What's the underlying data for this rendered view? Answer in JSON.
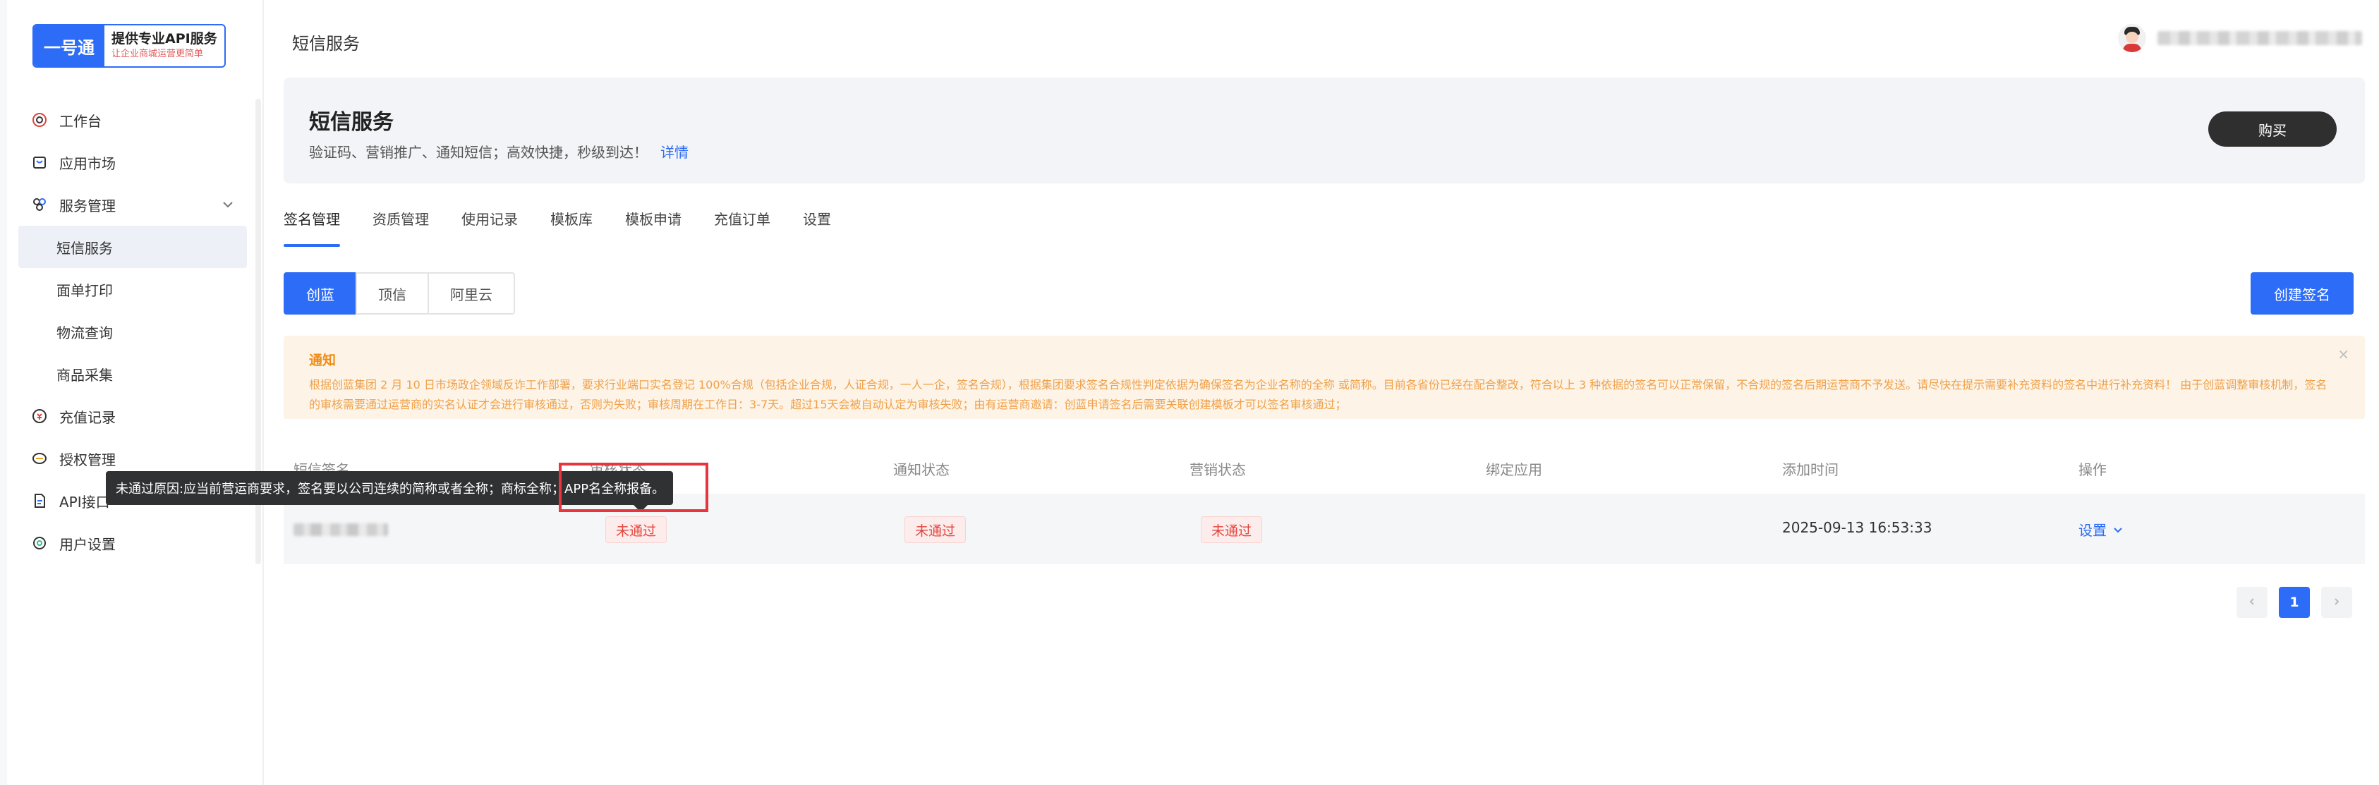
{
  "logo": {
    "mark": "一号通",
    "title": "提供专业API服务",
    "subtitle": "让企业商城运营更简单"
  },
  "sidebar": {
    "items": [
      {
        "label": "工作台"
      },
      {
        "label": "应用市场"
      },
      {
        "label": "服务管理"
      },
      {
        "label": "短信服务"
      },
      {
        "label": "面单打印"
      },
      {
        "label": "物流查询"
      },
      {
        "label": "商品采集"
      },
      {
        "label": "充值记录"
      },
      {
        "label": "授权管理"
      },
      {
        "label": "API接口"
      },
      {
        "label": "用户设置"
      }
    ]
  },
  "header": {
    "title": "短信服务"
  },
  "banner": {
    "title": "短信服务",
    "description": "验证码、营销推广、通知短信；高效快捷，秒级到达！",
    "detail_link": "详情",
    "buy_label": "购买"
  },
  "tabs": [
    "签名管理",
    "资质管理",
    "使用记录",
    "模板库",
    "模板申请",
    "充值订单",
    "设置"
  ],
  "providers": [
    "创蓝",
    "顶信",
    "阿里云"
  ],
  "create_button": "创建签名",
  "notice": {
    "title": "通知",
    "body": "根据创蓝集团 2 月 10 日市场政企领域反诈工作部署，要求行业端口实名登记 100%合规（包括企业合规，人证合规，一人一企，签名合规），根据集团要求签名合规性判定依据为确保签名为企业名称的全称 或简称。目前各省份已经在配合整改，符合以上 3 种依据的签名可以正常保留，不合规的签名后期运营商不予发送。请尽快在提示需要补充资料的签名中进行补充资料！ 由于创蓝调整审核机制，签名的审核需要通过运营商的实名认证才会进行审核通过，否则为失败；审核周期在工作日：3-7天。超过15天会被自动认定为审核失败；由有运营商邀请：创蓝申请签名后需要关联创建模板才可以签名审核通过；"
  },
  "table": {
    "columns": [
      "短信签名",
      "审核状态",
      "通知状态",
      "营销状态",
      "绑定应用",
      "添加时间",
      "操作"
    ],
    "rows": [
      {
        "audit_status": "未通过",
        "notify_status": "未通过",
        "marketing_status": "未通过",
        "bound_app": "",
        "added_time": "2025-09-13 16:53:33",
        "action": "设置"
      }
    ]
  },
  "pagination": {
    "current": "1"
  },
  "tooltip": {
    "text": "未通过原因:应当前营运商要求，签名要以公司连续的简称或者全称；商标全称；APP名全称报备。"
  },
  "colors": {
    "primary": "#2d6cf6",
    "danger": "#e2453c",
    "notice_bg": "#fdf4e7",
    "notice_text": "#f0a04a"
  }
}
